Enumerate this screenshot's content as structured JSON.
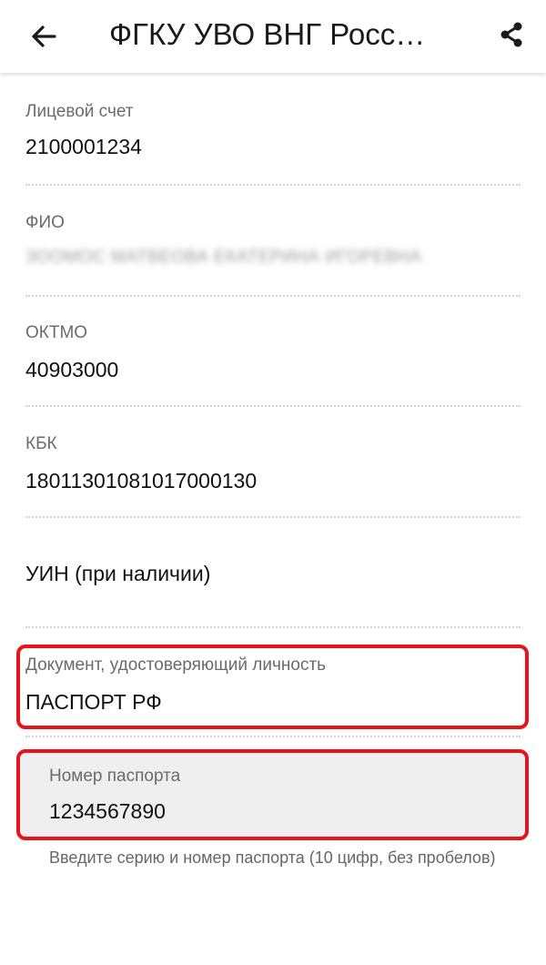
{
  "appbar": {
    "title": "ФГКУ УВО ВНГ Росс…",
    "back_icon": "arrow-left-icon",
    "share_icon": "share-icon"
  },
  "fields": {
    "account": {
      "label": "Лицевой счет",
      "value": "2100001234"
    },
    "fio": {
      "label": "ФИО",
      "value": "ЗООМОС МАТВЕОВА ЕКАТЕРИНА ИГОРЕВНА"
    },
    "oktmo": {
      "label": "ОКТМО",
      "value": "40903000"
    },
    "kbk": {
      "label": "КБК",
      "value": "18011301081017000130"
    },
    "uin": {
      "placeholder": "УИН (при наличии)"
    },
    "document": {
      "label": "Документ, удостоверяющий личность",
      "value": "ПАСПОРТ РФ"
    },
    "passport": {
      "label": "Номер паспорта",
      "value": "1234567890",
      "helper": "Введите серию и номер паспорта (10 цифр, без пробелов)"
    }
  },
  "colors": {
    "highlight": "#e8141a",
    "input_background": "#efefef"
  }
}
